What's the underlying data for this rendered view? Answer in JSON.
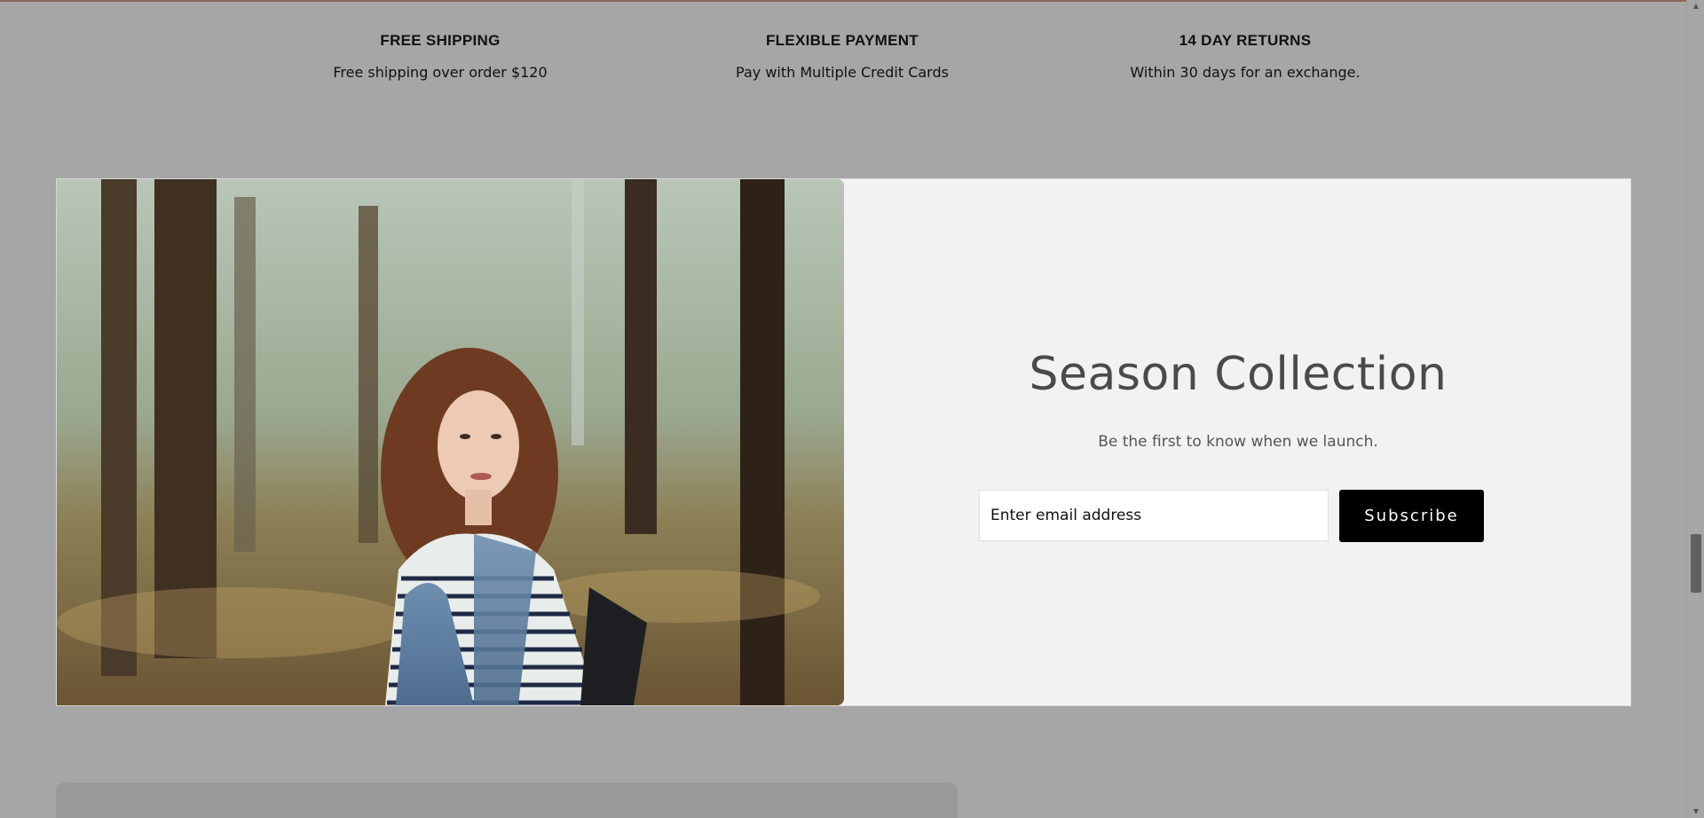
{
  "features": [
    {
      "title": "FREE SHIPPING",
      "desc": "Free shipping over order $120",
      "icon": "gift-icon"
    },
    {
      "title": "FLEXIBLE PAYMENT",
      "desc": "Pay with Multiple Credit Cards",
      "icon": "card-icon"
    },
    {
      "title": "14 DAY RETURNS",
      "desc": "Within 30 days for an exchange.",
      "icon": "return-icon"
    }
  ],
  "banner": {
    "title": "Season Collection",
    "subtitle": "Be the first to know when we launch.",
    "email_placeholder": "Enter email address",
    "subscribe_label": "Subscribe"
  },
  "colors": {
    "overlay": "#a6a6a6",
    "banner_bg": "#f2f2f2",
    "button_bg": "#000000"
  }
}
